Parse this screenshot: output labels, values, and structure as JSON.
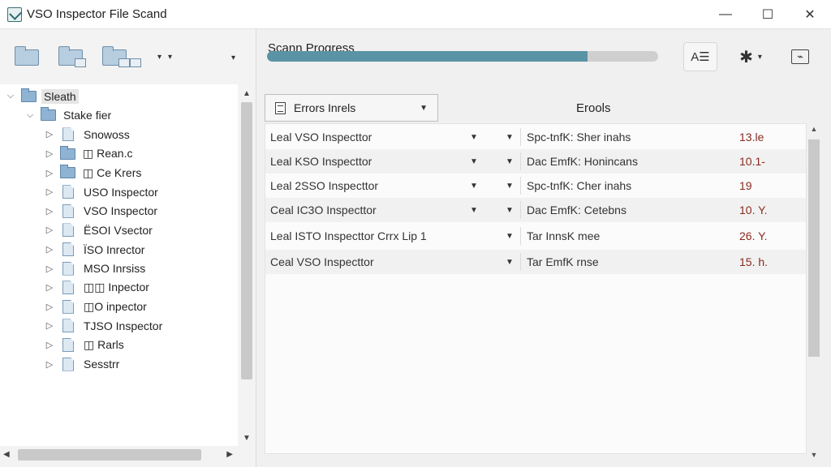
{
  "window": {
    "title": "VSO Inspector File Scand",
    "minimize": "—",
    "maximize": "☐",
    "close": "✕"
  },
  "left_toolbar": {
    "icons": [
      "folder-icon",
      "folder-doc-icon",
      "folder-group-icon"
    ],
    "dropdown_glyph": "▾"
  },
  "tree": {
    "items": [
      {
        "label": "Sleath",
        "level": 0,
        "expanded": true,
        "icon": "folder",
        "selected": true
      },
      {
        "label": "Stake fier",
        "level": 1,
        "expanded": true,
        "icon": "folder"
      },
      {
        "label": "Snowoss",
        "level": 2,
        "icon": "file"
      },
      {
        "label": "◫ Rean.c",
        "level": 2,
        "icon": "folder"
      },
      {
        "label": "◫ Ce Krers",
        "level": 2,
        "icon": "folder"
      },
      {
        "label": "USO Inspector",
        "level": 2,
        "icon": "file"
      },
      {
        "label": "VSO Inspector",
        "level": 2,
        "icon": "file"
      },
      {
        "label": "ЁSOI Vsector",
        "level": 2,
        "icon": "file"
      },
      {
        "label": "ЇSO Inrector",
        "level": 2,
        "icon": "file"
      },
      {
        "label": "MSO Inrsiss",
        "level": 2,
        "icon": "file"
      },
      {
        "label": "◫◫ Inpector",
        "level": 2,
        "icon": "file"
      },
      {
        "label": "◫O inpector",
        "level": 2,
        "icon": "file"
      },
      {
        "label": "TJSO Inspector",
        "level": 2,
        "icon": "file"
      },
      {
        "label": "◫ Rarls",
        "level": 2,
        "icon": "file"
      },
      {
        "label": "Sesstrr",
        "level": 2,
        "icon": "file"
      }
    ]
  },
  "progress": {
    "label": "Scann Progress",
    "value": 0.82
  },
  "right_toolbar": {
    "text_icon_label": "A☰",
    "settings_icon": "✱",
    "monitor_icon": "⌁"
  },
  "grid": {
    "filter_label": "Errors Inrels",
    "header_title": "Erools",
    "rows": [
      {
        "name": "Leal VSO Inspecttor",
        "detail": "Spc-tnfK: Sher inahs",
        "value": "13.le",
        "dropdown1": true
      },
      {
        "name": "Leal KSO Inspecttor",
        "detail": "Dac EmfK: Honincans",
        "value": "10.1-",
        "dropdown1": true
      },
      {
        "name": "Leal 2SSO Inspecttor",
        "detail": "Spc-tnfK: Cher inahs",
        "value": "19",
        "dropdown1": true
      },
      {
        "name": "Ceal IC3O Inspecttor",
        "detail": "Dac EmfK: Cetebns",
        "value": "10. Y.",
        "dropdown1": true
      },
      {
        "name": "Leal ISTO Inspecttor Crrx Lip 1",
        "detail": "Tar InnsK mee",
        "value": "26. Y.",
        "dropdown1": false
      },
      {
        "name": "Ceal VSO Inspecttor",
        "detail": "Tar EmfK rnse",
        "value": "15. h.",
        "dropdown1": false
      }
    ]
  }
}
